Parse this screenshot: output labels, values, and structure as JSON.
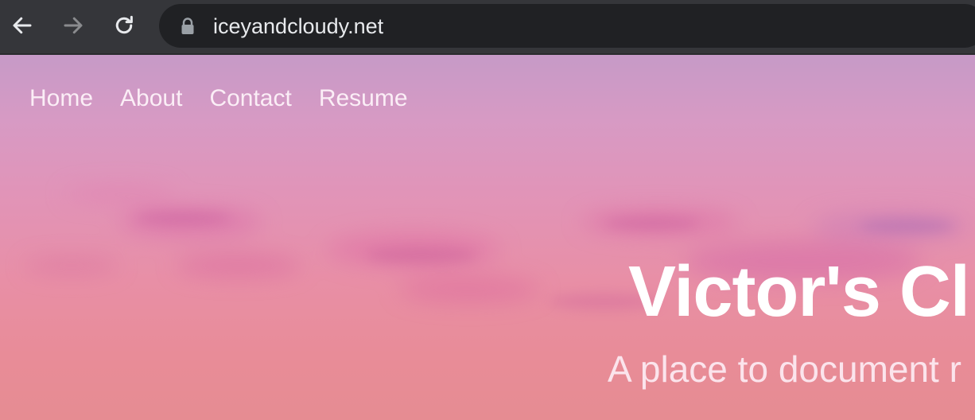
{
  "browser": {
    "url": "iceyandcloudy.net",
    "icons": {
      "back": "arrow-left-icon",
      "forward": "arrow-right-icon",
      "reload": "reload-icon",
      "lock": "lock-icon"
    }
  },
  "site": {
    "nav": [
      {
        "label": "Home"
      },
      {
        "label": "About"
      },
      {
        "label": "Contact"
      },
      {
        "label": "Resume"
      }
    ],
    "title": "Victor's Cl",
    "subtitle": "A place to document r"
  },
  "colors": {
    "toolbar": "#35363a",
    "omnibox": "#202124",
    "sky_top": "#c69ac7",
    "sky_bottom": "#e68c92",
    "hero_text": "#ffffff"
  }
}
